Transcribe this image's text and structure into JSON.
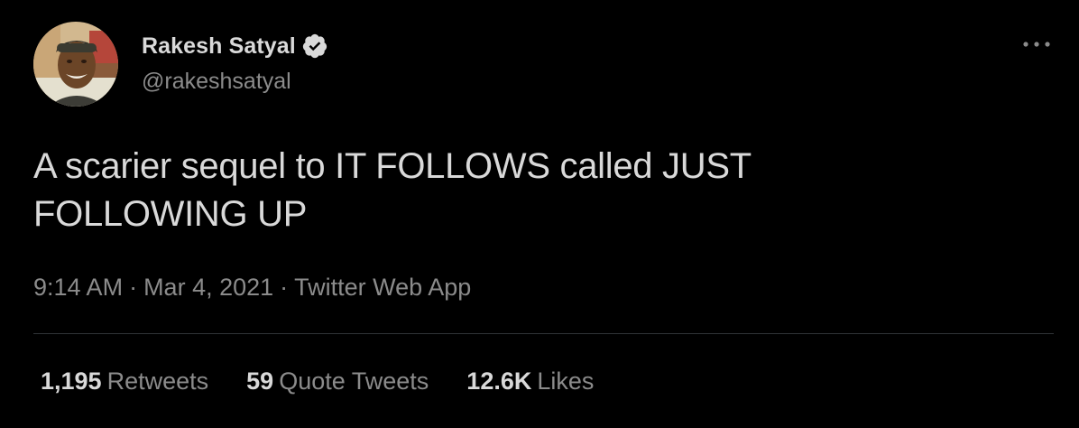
{
  "user": {
    "display_name": "Rakesh Satyal",
    "handle": "@rakeshsatyal",
    "verified": true,
    "avatar_icon": "profile-photo"
  },
  "tweet": {
    "text": "A scarier sequel to IT FOLLOWS called JUST\nFOLLOWING UP",
    "time": "9:14 AM",
    "date": "Mar 4, 2021",
    "source": "Twitter Web App",
    "separator": "·"
  },
  "stats": {
    "retweets_count": "1,195",
    "retweets_label": "Retweets",
    "quotes_count": "59",
    "quotes_label": "Quote Tweets",
    "likes_count": "12.6K",
    "likes_label": "Likes"
  },
  "colors": {
    "background": "#000000",
    "primary_text": "#d9d9d9",
    "secondary_text": "#8b8b8b",
    "divider": "#2f3336"
  },
  "icons": {
    "verified": "verified-badge-icon",
    "more": "more-options-icon"
  }
}
